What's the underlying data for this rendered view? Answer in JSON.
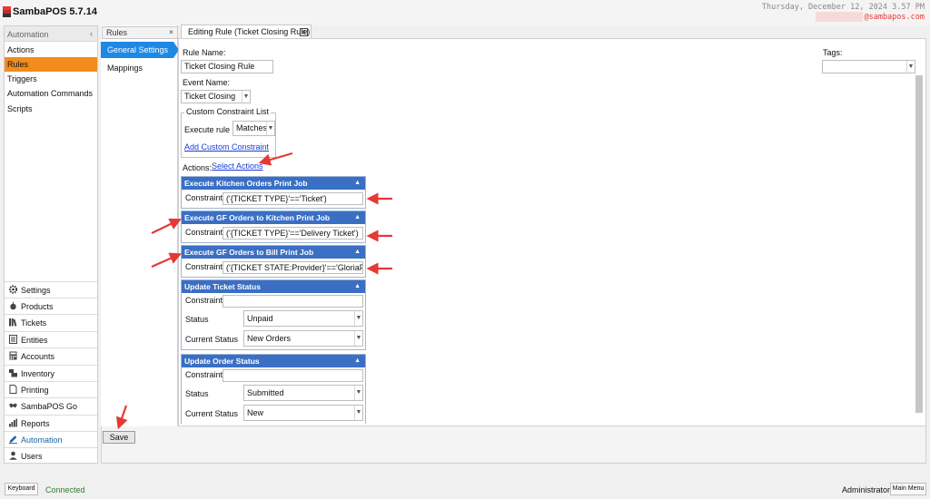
{
  "app": {
    "title": "SambaPOS 5.7.14",
    "datetime": "Thursday, December 12, 2024 3.57 PM",
    "user_email": "@sambapos.com",
    "accent": "#f28c1c"
  },
  "nav": {
    "header": "Automation",
    "collapse_icon": "chevron-left-icon",
    "items": [
      {
        "label": "Actions",
        "active": false
      },
      {
        "label": "Rules",
        "active": true
      },
      {
        "label": "Triggers",
        "active": false
      },
      {
        "label": "Automation Commands",
        "active": false
      },
      {
        "label": "Scripts",
        "active": false
      }
    ],
    "modules": [
      {
        "label": "Settings",
        "icon": "gear-icon"
      },
      {
        "label": "Products",
        "icon": "apple-icon"
      },
      {
        "label": "Tickets",
        "icon": "books-icon"
      },
      {
        "label": "Entities",
        "icon": "list-icon"
      },
      {
        "label": "Accounts",
        "icon": "calculator-icon"
      },
      {
        "label": "Inventory",
        "icon": "boxes-icon"
      },
      {
        "label": "Printing",
        "icon": "document-icon"
      },
      {
        "label": "SambaPOS Go",
        "icon": "handshake-icon"
      },
      {
        "label": "Reports",
        "icon": "bar-chart-icon"
      },
      {
        "label": "Automation",
        "icon": "pencil-icon",
        "active": true
      },
      {
        "label": "Users",
        "icon": "user-icon"
      }
    ]
  },
  "rules_panel": {
    "tab_label": "Rules",
    "tab_close": "×",
    "items": [
      {
        "label": "General Settings",
        "active": true
      },
      {
        "label": "Mappings",
        "active": false
      }
    ]
  },
  "editor": {
    "tab_label": "Editing Rule (Ticket Closing Rule)",
    "tab_close": "×",
    "rule_name_label": "Rule Name:",
    "rule_name_value": "Ticket Closing Rule",
    "event_name_label": "Event Name:",
    "event_name_value": "Ticket Closing",
    "tags_label": "Tags:",
    "tags_value": "",
    "custom_constraint": {
      "legend": "Custom Constraint List",
      "execute_label": "Execute rule if",
      "execute_value": "Matches",
      "add_link": "Add Custom Constraint"
    },
    "actions_label": "Actions:",
    "select_actions_link": "Select Actions",
    "actions": [
      {
        "title": "Execute Kitchen Orders Print Job",
        "constraint_label": "Constraint:",
        "constraint": "('{TICKET TYPE}'=='Ticket')"
      },
      {
        "title": "Execute GF Orders to Kitchen Print Job",
        "constraint_label": "Constraint:",
        "constraint": "('{TICKET TYPE}'=='Delivery Ticket')"
      },
      {
        "title": "Execute GF Orders to Bill Print Job",
        "constraint_label": "Constraint:",
        "constraint": "('{TICKET STATE:Provider}'=='GloriaFood')"
      },
      {
        "title": "Update Ticket Status",
        "constraint_label": "Constraint:",
        "constraint": "",
        "status_label": "Status",
        "status": "Unpaid",
        "current_status_label": "Current Status",
        "current_status": "New Orders"
      },
      {
        "title": "Update Order Status",
        "constraint_label": "Constraint:",
        "constraint": "",
        "status_label": "Status",
        "status": "Submitted",
        "current_status_label": "Current Status",
        "current_status": "New"
      }
    ],
    "save_label": "Save"
  },
  "status_bar": {
    "keyboard": "Keyboard",
    "connection": "Connected",
    "user": "Administrator",
    "main_menu": "Main Menu"
  },
  "colors": {
    "action_header": "#3a6fc4",
    "selected": "#1e88e5",
    "callout_arrow": "#e53935",
    "connected": "#2e7d32"
  }
}
